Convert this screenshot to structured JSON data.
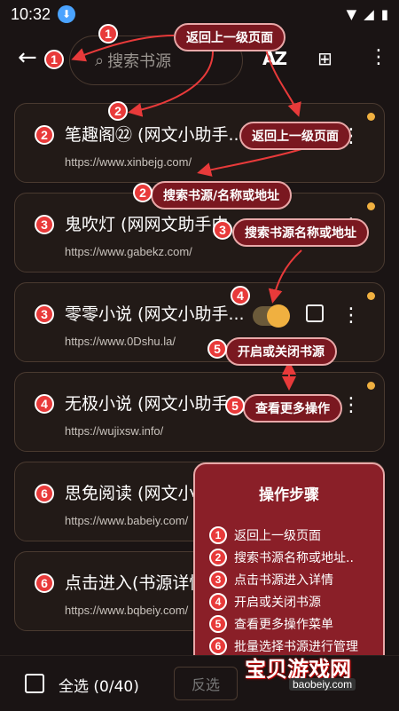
{
  "status_bar": {
    "time": "10:32"
  },
  "search": {
    "placeholder": "搜索书源"
  },
  "toolbar": {
    "az_label": "AZ"
  },
  "cards": [
    {
      "badge": "2",
      "title": "笔趣阁㉒ (网文小助手...",
      "url": "https://www.xinbejg.com/"
    },
    {
      "badge": "3",
      "title": "鬼吹灯 (网网文助手内",
      "url": "https://www.gabekz.com/"
    },
    {
      "badge": "3",
      "title": "零零小说 (网文小助手...",
      "url": "https://www.0Dshu.la/"
    },
    {
      "badge": "4",
      "title": "无极小说 (网文小助手...",
      "url": "https://wujixsw.info/"
    },
    {
      "badge": "6",
      "title": "思免阅读 (网文小...",
      "url": "https://www.babeiy.com/"
    },
    {
      "badge": "6",
      "title": "点击进入(书源详情...",
      "url": "https://www.bqbeiy.com/"
    }
  ],
  "callouts": {
    "c1": {
      "badge": "1",
      "text": "返回上一级页面"
    },
    "c2_card": {
      "text": "返回上一级页面"
    },
    "c2": {
      "badge": "2",
      "text": "搜索书源/名称或地址"
    },
    "c3": {
      "badge": "3",
      "text": "搜索书源名称或地址"
    },
    "c4": {
      "badge": "4"
    },
    "c5a": {
      "badge": "5",
      "text": "开启或关闭书源"
    },
    "c5b": {
      "badge": "5",
      "text": "查看更多操作"
    },
    "back_badge": "1",
    "badge_2_float": "2"
  },
  "steps": {
    "title": "操作步骤",
    "items": [
      {
        "n": "1",
        "text": "返回上一级页面"
      },
      {
        "n": "2",
        "text": "搜索书源名称或地址.."
      },
      {
        "n": "3",
        "text": "点击书源进入详情"
      },
      {
        "n": "4",
        "text": "开启或关闭书源"
      },
      {
        "n": "5",
        "text": "查看更多操作菜单"
      },
      {
        "n": "6",
        "text": "批量选择书源进行管理"
      }
    ]
  },
  "watermark": {
    "text": "宝贝游戏网",
    "url": "baobeiy.com"
  },
  "bottom": {
    "select_all": "全选 (0/40)",
    "invert": "反选"
  },
  "colors": {
    "accent": "#f0b040",
    "callout_bg": "#7a1820",
    "badge": "#e83a3a"
  }
}
